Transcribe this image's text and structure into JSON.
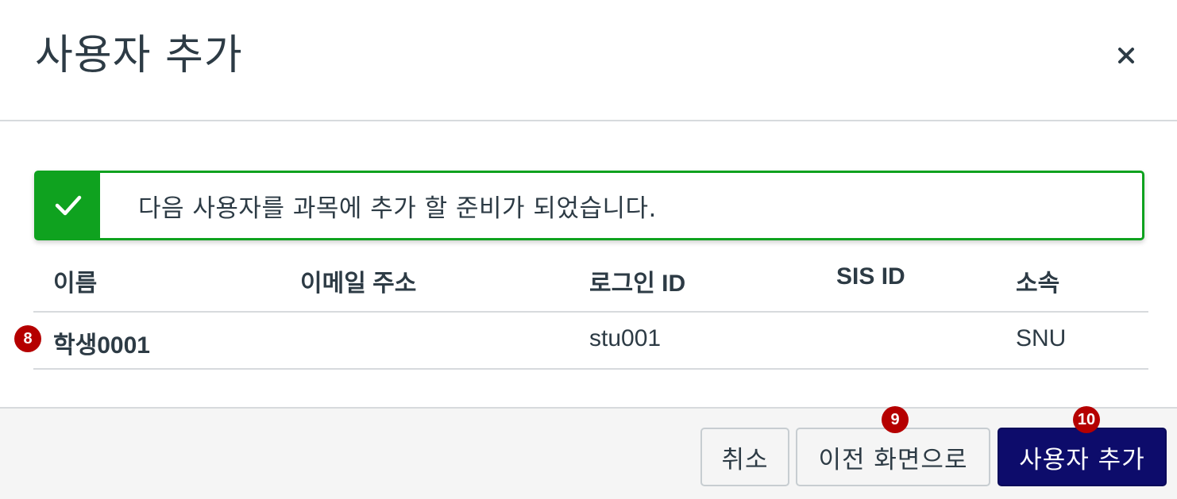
{
  "dialog": {
    "title": "사용자 추가",
    "close_icon": "close-icon"
  },
  "alert": {
    "icon": "checkmark-icon",
    "message": "다음 사용자를 과목에 추가 할 준비가 되었습니다.",
    "accent_color": "#0fa21f"
  },
  "table": {
    "headers": {
      "name": "이름",
      "email": "이메일 주소",
      "login_id": "로그인 ID",
      "sis_id": "SIS ID",
      "institution": "소속"
    },
    "rows": [
      {
        "name": "학생0001",
        "email": "",
        "login_id": "stu001",
        "sis_id": "",
        "institution": "SNU"
      }
    ]
  },
  "footer": {
    "cancel_label": "취소",
    "back_label": "이전 화면으로",
    "add_label": "사용자 추가",
    "primary_color": "#0d0c6b"
  },
  "badges": {
    "row_badge": "8",
    "back_badge": "9",
    "add_badge": "10",
    "color": "#b50000"
  }
}
